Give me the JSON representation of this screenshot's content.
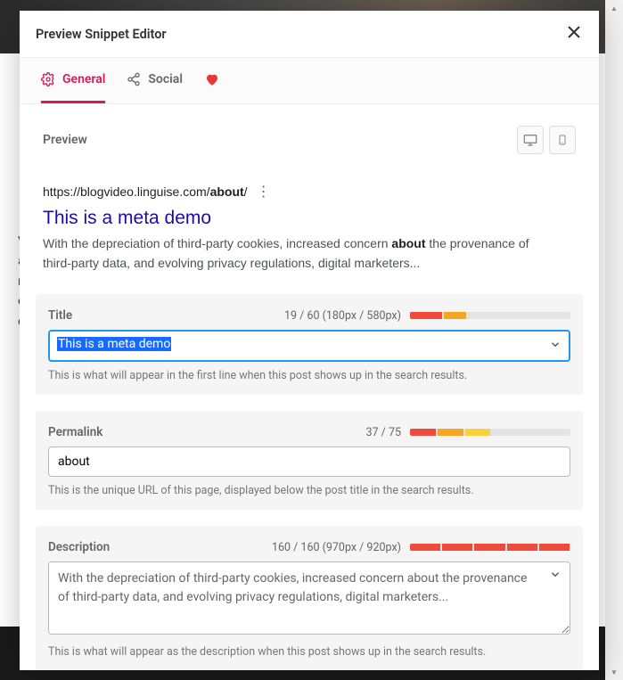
{
  "header": {
    "title": "Preview Snippet Editor"
  },
  "tabs": {
    "general": "General",
    "social": "Social"
  },
  "preview": {
    "label": "Preview",
    "url_prefix": "https://blogvideo.linguise.com/",
    "url_bold": "about",
    "url_suffix": "/",
    "serp_title": "This is a meta demo",
    "serp_desc_prefix": "With the depreciation of third-party cookies, increased concern ",
    "serp_desc_bold": "about",
    "serp_desc_suffix": " the provenance of third-party data, and evolving privacy regulations, digital marketers..."
  },
  "fields": {
    "title": {
      "label": "Title",
      "stats": "19 / 60 (180px / 580px)",
      "value": "This is a meta demo",
      "help": "This is what will appear in the first line when this post shows up in the search results."
    },
    "permalink": {
      "label": "Permalink",
      "stats": "37 / 75",
      "value": "about",
      "help": "This is the unique URL of this page, displayed below the post title in the search results."
    },
    "description": {
      "label": "Description",
      "stats": "160 / 160 (970px / 920px)",
      "value": "With the depreciation of third-party cookies, increased concern about the provenance of third-party data, and evolving privacy regulations, digital marketers...",
      "help": "This is what will appear as the description when this post shows up in the search results."
    }
  }
}
